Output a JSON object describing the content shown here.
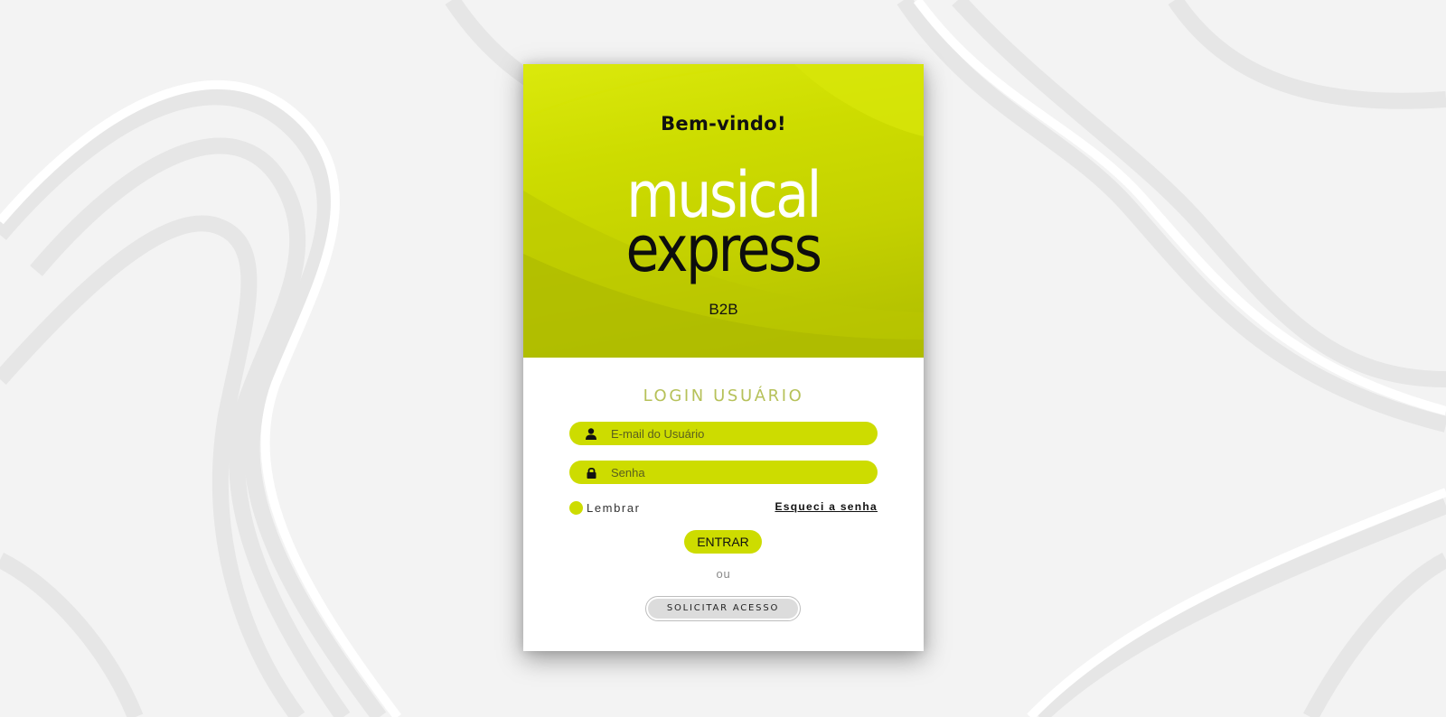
{
  "header": {
    "welcome": "Bem-vindo!",
    "logo_line1": "musical",
    "logo_line2": "express",
    "subtitle": "B2B"
  },
  "login": {
    "title": "LOGIN USUÁRIO",
    "email_placeholder": "E-mail do Usuário",
    "email_value": "",
    "email_icon": "user-icon",
    "password_placeholder": "Senha",
    "password_value": "",
    "password_icon": "lock-icon",
    "remember_label": "Lembrar",
    "forgot_label": "Esqueci a senha",
    "submit_label": "ENTRAR",
    "or_label": "ou",
    "request_label": "SOLICITAR ACESSO"
  },
  "colors": {
    "accent": "#cddc00",
    "title_accent": "#b6c159",
    "background": "#f3f3f3"
  }
}
